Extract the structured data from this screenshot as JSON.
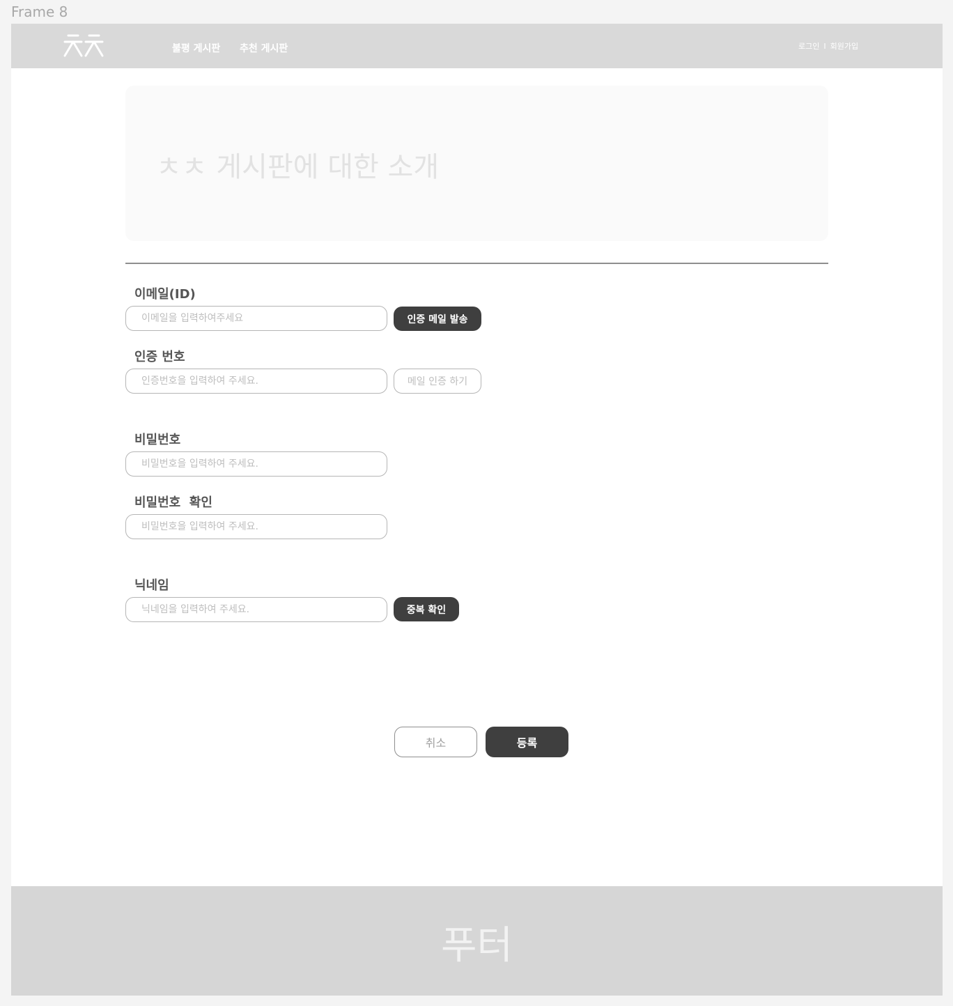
{
  "frame": {
    "label": "Frame 8"
  },
  "header": {
    "logo_icon": "double-cheot-logo",
    "nav": [
      {
        "label": "불평 게시판"
      },
      {
        "label": "추천 게시판"
      }
    ],
    "auth": {
      "login": "로그인",
      "separator": "I",
      "signup": "회원가입"
    }
  },
  "intro": {
    "text": "ㅊㅊ 게시판에 대한 소개"
  },
  "form": {
    "email": {
      "label": "이메일(ID)",
      "placeholder": "이메일을 입력하여주세요",
      "value": "",
      "button": "인증 메일 발송"
    },
    "code": {
      "label": "인증 번호",
      "placeholder": "인증번호을 입력하여 주세요.",
      "value": "",
      "button": "메일 인증 하기"
    },
    "password": {
      "label": "비밀번호",
      "placeholder": "비밀번호을 입력하여 주세요.",
      "value": ""
    },
    "password_confirm": {
      "label": "비밀번호  확인",
      "placeholder": "비밀번호을 입력하여 주세요.",
      "value": ""
    },
    "nickname": {
      "label": "닉네임",
      "placeholder": "닉네임을 입력하여 주세요.",
      "value": "",
      "button": "중복 확인"
    }
  },
  "actions": {
    "cancel": "취소",
    "submit": "등록"
  },
  "footer": {
    "text": "푸터"
  },
  "colors": {
    "header_bg": "#d9d9d9",
    "dark_button": "#3f3f3f",
    "footer_bg": "#d6d6d6"
  }
}
